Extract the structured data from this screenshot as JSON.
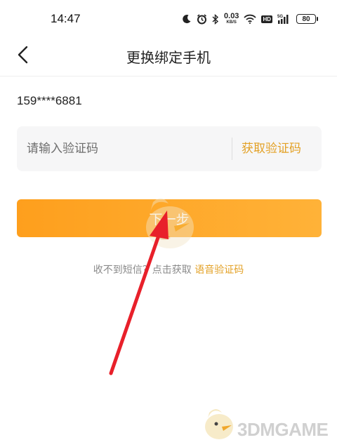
{
  "status_bar": {
    "time": "14:47",
    "network_speed_value": "0.03",
    "network_speed_unit": "KB/S",
    "hd_label": "HD",
    "signal_label": "5G",
    "battery_level": "80"
  },
  "nav": {
    "title": "更换绑定手机",
    "back_icon": "chevron-left-icon"
  },
  "phone": {
    "masked_number": "159****6881"
  },
  "verification": {
    "placeholder": "请输入验证码",
    "value": "",
    "get_code_label": "获取验证码"
  },
  "next_button": {
    "label": "下一步"
  },
  "hint": {
    "text": "收不到短信？点击获取",
    "voice_code_label": "语音验证码"
  },
  "watermark": {
    "text": "3DMGAME"
  },
  "colors": {
    "accent": "#e3a126",
    "button_start": "#fe9f1d",
    "button_end": "#ffb238",
    "annotation_arrow": "#e8202a"
  }
}
